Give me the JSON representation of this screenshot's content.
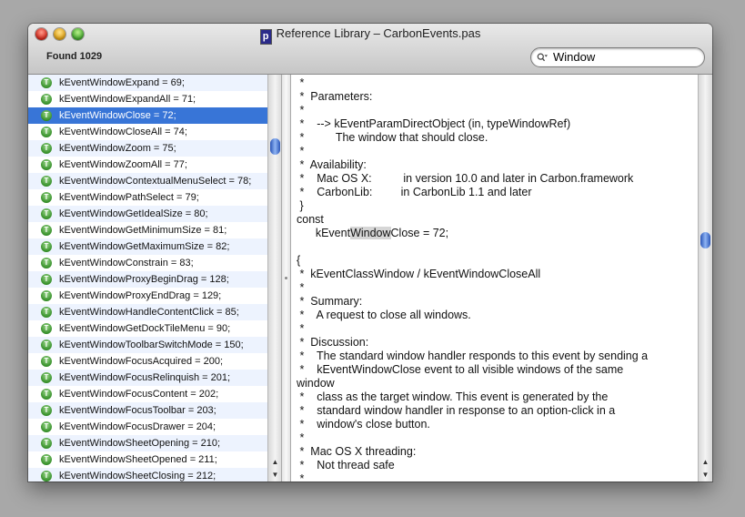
{
  "window": {
    "title": "Reference Library – CarbonEvents.pas",
    "doc_icon_letter": "p",
    "found_label": "Found 1029"
  },
  "search": {
    "value": "Window",
    "icon": "magnifier-dropdown-icon"
  },
  "list": {
    "items": [
      "kEventWindowExpand = 69;",
      "kEventWindowExpandAll = 71;",
      "kEventWindowClose = 72;",
      "kEventWindowCloseAll = 74;",
      "kEventWindowZoom = 75;",
      "kEventWindowZoomAll = 77;",
      "kEventWindowContextualMenuSelect = 78;",
      "kEventWindowPathSelect = 79;",
      "kEventWindowGetIdealSize = 80;",
      "kEventWindowGetMinimumSize = 81;",
      "kEventWindowGetMaximumSize = 82;",
      "kEventWindowConstrain = 83;",
      "kEventWindowProxyBeginDrag = 128;",
      "kEventWindowProxyEndDrag = 129;",
      "kEventWindowHandleContentClick = 85;",
      "kEventWindowGetDockTileMenu = 90;",
      "kEventWindowToolbarSwitchMode = 150;",
      "kEventWindowFocusAcquired = 200;",
      "kEventWindowFocusRelinquish = 201;",
      "kEventWindowFocusContent = 202;",
      "kEventWindowFocusToolbar = 203;",
      "kEventWindowFocusDrawer = 204;",
      "kEventWindowSheetOpening = 210;",
      "kEventWindowSheetOpened = 211;",
      "kEventWindowSheetClosing = 212;"
    ],
    "selected_index": 2,
    "badge_letter": "T"
  },
  "code": {
    "before_highlight": " *\n *  Parameters:\n *\n *    --> kEventParamDirectObject (in, typeWindowRef)\n *          The window that should close.\n *\n *  Availability:\n *    Mac OS X:          in version 10.0 and later in Carbon.framework\n *    CarbonLib:         in CarbonLib 1.1 and later\n }\nconst\n      kEvent",
    "highlight": "Window",
    "after_highlight": "Close = 72;\n\n{\n *  kEventClassWindow / kEventWindowCloseAll\n *\n *  Summary:\n *    A request to close all windows.\n *\n *  Discussion:\n *    The standard window handler responds to this event by sending a\n *    kEventWindowClose event to all visible windows of the same\nwindow\n *    class as the target window. This event is generated by the\n *    standard window handler in response to an option-click in a\n *    window's close button.\n *\n *  Mac OS X threading:\n *    Not thread safe\n *"
  }
}
